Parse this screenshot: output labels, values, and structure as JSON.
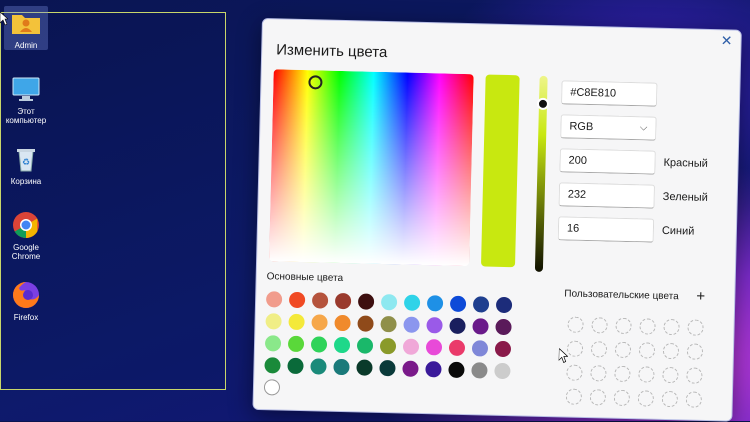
{
  "desktop": {
    "icons": [
      {
        "label": "Admin",
        "icon": "user-folder-icon"
      },
      {
        "label": "Этот\nкомпьютер",
        "icon": "monitor-icon"
      },
      {
        "label": "Корзина",
        "icon": "recycle-bin-icon"
      },
      {
        "label": "Google\nChrome",
        "icon": "chrome-icon"
      },
      {
        "label": "Firefox",
        "icon": "firefox-icon"
      }
    ]
  },
  "dialog": {
    "title": "Изменить цвета",
    "close_icon": "close-icon",
    "hex_value": "#C8E810",
    "mode_value": "RGB",
    "red_value": "200",
    "green_value": "232",
    "blue_value": "16",
    "red_label": "Красный",
    "green_label": "Зеленый",
    "blue_label": "Синий",
    "basic_colors_title": "Основные цвета",
    "custom_colors_title": "Пользовательские цвета",
    "custom_add_label": "+",
    "preview_color": "#C8E810",
    "basic_colors": [
      "#f19c8c",
      "#f04a24",
      "#b5533d",
      "#9a3a2d",
      "#3d0f0f",
      "#8ee8f0",
      "#2fd3e8",
      "#1e90e6",
      "#0d4ad8",
      "#1f3f8f",
      "#1c2c7a",
      "#f0ee86",
      "#f4e93a",
      "#f6a74a",
      "#f08a2c",
      "#8f4a1a",
      "#8f8f4a",
      "#8b96ee",
      "#9a5ae8",
      "#1a1f5e",
      "#6a1a8a",
      "#5a1a5a",
      "#8ae88a",
      "#5ad83a",
      "#2fd35a",
      "#1ed88a",
      "#1ab86a",
      "#8a9a2a",
      "#f0a8d8",
      "#e84ad8",
      "#ea3a6a",
      "#7f87d8",
      "#8a1a4a",
      "#1a8a3a",
      "#0a6a3a",
      "#1a8a7a",
      "#1a7a7a",
      "#0a3a2a",
      "#0a3a3a",
      "#7a1a8a",
      "#3a1a9a",
      "#0a0a0a",
      "#8a8a8a",
      "#cccccc",
      "#ffffff"
    ],
    "custom_slots": 24
  }
}
